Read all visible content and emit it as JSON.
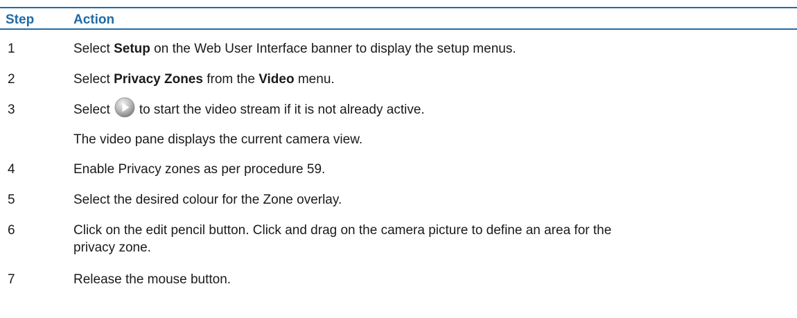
{
  "table": {
    "header": {
      "step": "Step",
      "action": "Action"
    },
    "rows": [
      {
        "num": "1",
        "parts": [
          "Select ",
          "Setup",
          " on the Web User Interface banner to display the setup menus."
        ]
      },
      {
        "num": "2",
        "parts": [
          "Select ",
          "Privacy Zones",
          " from the ",
          "Video",
          " menu."
        ]
      },
      {
        "num": "3",
        "before": "Select",
        "icon": "play-icon",
        "after": "to start the video stream if it is not already active.",
        "note": "The video pane displays the current camera view."
      },
      {
        "num": "4",
        "text": "Enable Privacy zones as per procedure 59."
      },
      {
        "num": "5",
        "text": "Select the desired colour for the Zone overlay."
      },
      {
        "num": "6",
        "line1": "Click on the edit pencil button. Click and drag on the camera picture to define an area for the",
        "line2": "privacy zone."
      },
      {
        "num": "7",
        "text": "Release the mouse button."
      }
    ]
  },
  "colors": {
    "accent": "#1f6aa8",
    "text": "#1a1a1a"
  }
}
